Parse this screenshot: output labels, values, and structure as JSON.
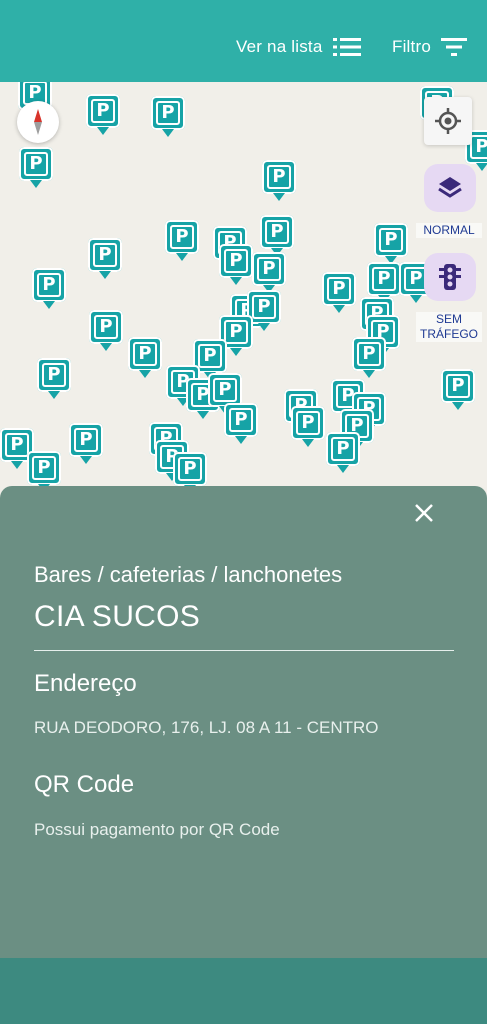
{
  "header": {
    "list_label": "Ver na lista",
    "filter_label": "Filtro"
  },
  "map": {
    "layer_label": "NORMAL",
    "traffic_label_line1": "SEM",
    "traffic_label_line2": "TRÁFEGO",
    "pin_glyph": "P"
  },
  "detail": {
    "category": "Bares / cafeterias / lanchonetes",
    "name": "CIA SUCOS",
    "address_heading": "Endereço",
    "address": "RUA DEODORO, 176, LJ. 08 A 11 - CENTRO",
    "qr_heading": "QR Code",
    "qr_text": "Possui pagamento por QR Code"
  },
  "colors": {
    "header": "#2fb0a8",
    "pin": "#16a3a6",
    "sheet": "#6b8f83",
    "map": "#f1efe9"
  }
}
